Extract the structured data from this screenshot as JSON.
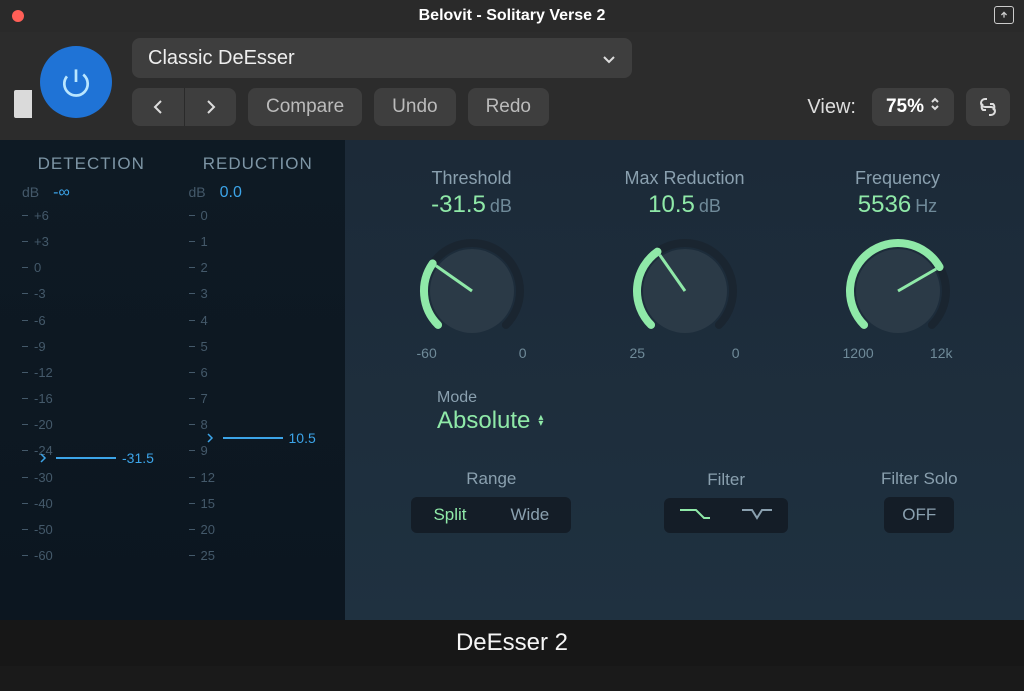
{
  "window": {
    "title": "Belovit - Solitary Verse 2"
  },
  "toolbar": {
    "preset": "Classic DeEsser",
    "compare": "Compare",
    "undo": "Undo",
    "redo": "Redo",
    "view_label": "View:",
    "view_pct": "75%"
  },
  "meters": {
    "detection": {
      "title": "DETECTION",
      "unit": "dB",
      "value": "-∞",
      "ticks": [
        "+6",
        "+3",
        "0",
        "-3",
        "-6",
        "-9",
        "-12",
        "-16",
        "-20",
        "-24",
        "-30",
        "-40",
        "-50",
        "-60"
      ],
      "marker": "-31.5",
      "marker_pos_pct": 73
    },
    "reduction": {
      "title": "REDUCTION",
      "unit": "dB",
      "value": "0.0",
      "ticks": [
        "0",
        "1",
        "2",
        "3",
        "4",
        "5",
        "6",
        "7",
        "8",
        "9",
        "12",
        "15",
        "20",
        "25"
      ],
      "marker": "10.5",
      "marker_pos_pct": 67
    }
  },
  "knobs": {
    "threshold": {
      "label": "Threshold",
      "value": "-31.5",
      "unit": "dB",
      "min": "-60",
      "max": "0",
      "angle": -55
    },
    "max_reduction": {
      "label": "Max Reduction",
      "value": "10.5",
      "unit": "dB",
      "min": "25",
      "max": "0",
      "angle": -35
    },
    "frequency": {
      "label": "Frequency",
      "value": "5536",
      "unit": "Hz",
      "min": "1200",
      "max": "12k",
      "angle": 60
    }
  },
  "mode": {
    "label": "Mode",
    "value": "Absolute"
  },
  "range": {
    "label": "Range",
    "opt1": "Split",
    "opt2": "Wide",
    "active": "Split"
  },
  "filter": {
    "label": "Filter"
  },
  "filter_solo": {
    "label": "Filter Solo",
    "value": "OFF"
  },
  "footer": {
    "name": "DeEsser 2"
  }
}
